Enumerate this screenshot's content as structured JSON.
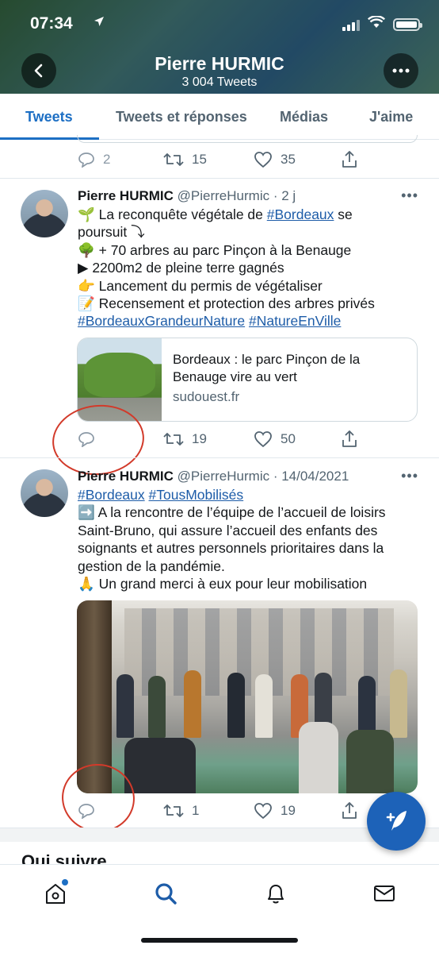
{
  "status_bar": {
    "time": "07:34",
    "location_icon": "location-arrow-icon"
  },
  "header": {
    "name": "Pierre HURMIC",
    "tweet_count": "3 004 Tweets",
    "back_icon": "chevron-left-icon",
    "more_icon": "more-horizontal-icon"
  },
  "tabs": [
    "Tweets",
    "Tweets et réponses",
    "Médias",
    "J'aime"
  ],
  "tweets": [
    {
      "reply_count": "2",
      "retweet_count": "15",
      "like_count": "35"
    },
    {
      "author": "Pierre HURMIC",
      "meta": "@PierreHurmic · 2 j",
      "lines": [
        {
          "pre": "🌱 La reconquête végétale de ",
          "link": "#Bordeaux",
          "post": " se"
        },
        {
          "text": "poursuit ⤵"
        },
        {
          "text": "🌳 + 70 arbres au parc Pinçon à la Benauge"
        },
        {
          "text": "▶ 2200m2 de pleine terre gagnés"
        },
        {
          "text": "👉 Lancement du permis de végétaliser"
        },
        {
          "text": "📝 Recensement et protection des arbres privés"
        }
      ],
      "hashtags": [
        "#BordeauxGrandeurNature",
        "#NatureEnVille"
      ],
      "card": {
        "title": "Bordeaux : le parc Pinçon de la Benauge vire au vert",
        "domain": "sudouest.fr"
      },
      "reply_count": "",
      "retweet_count": "19",
      "like_count": "50"
    },
    {
      "author": "Pierre HURMIC",
      "meta": "@PierreHurmic · 14/04/2021",
      "hashtags": [
        "#Bordeaux",
        "#TousMobilisés"
      ],
      "lines": [
        {
          "text": "➡️ A la rencontre de l’équipe de l’accueil de loisirs"
        },
        {
          "text": "Saint-Bruno, qui assure l’accueil des enfants des"
        },
        {
          "text": "soignants et autres personnels prioritaires dans la"
        },
        {
          "text": "gestion de la pandémie."
        },
        {
          "text": "🙏 Un grand merci à eux pour leur mobilisation"
        }
      ],
      "reply_count": "",
      "retweet_count": "1",
      "like_count": "19"
    }
  ],
  "who_to_follow": "Qui suivre",
  "bottom_nav": [
    "home-icon",
    "search-icon",
    "bell-icon",
    "mail-icon"
  ],
  "colors": {
    "accent": "#1d6fc4",
    "link": "#1d5ca8",
    "annotation": "#d23a2a"
  }
}
